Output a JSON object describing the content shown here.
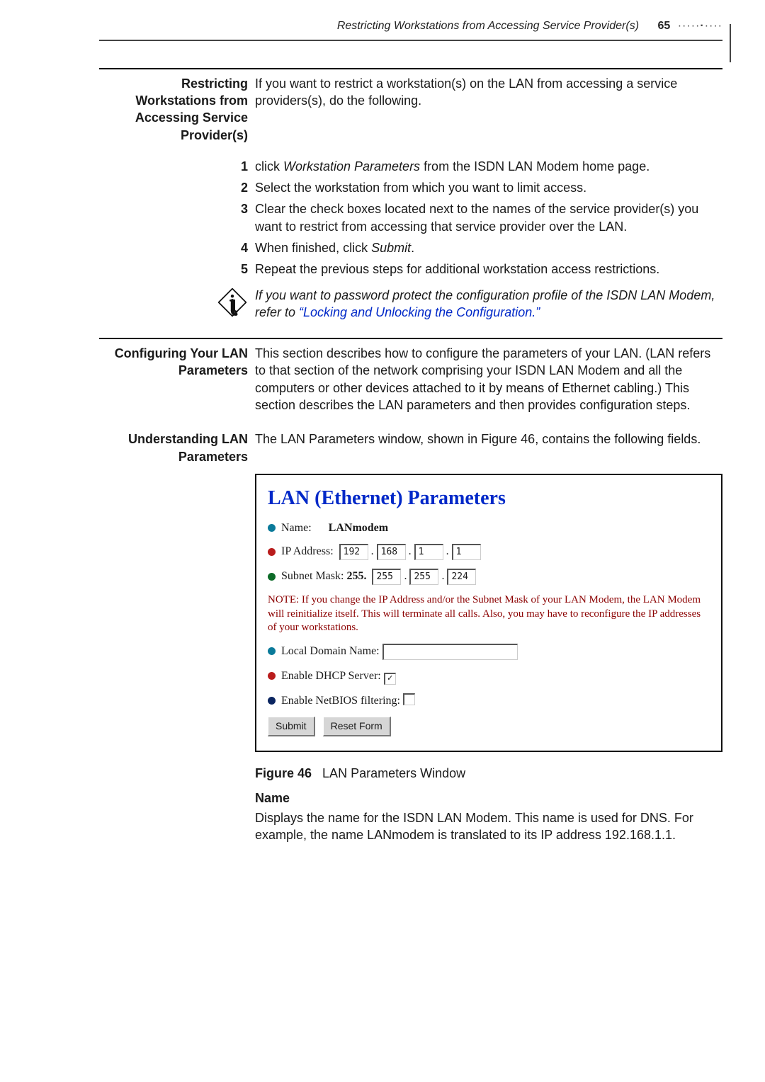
{
  "running": {
    "title": "Restricting Workstations from Accessing Service Provider(s)",
    "page": "65"
  },
  "sec1": {
    "heading": "Restricting Workstations from Accessing Service Provider(s)",
    "intro": "If you want to restrict a workstation(s) on the LAN from accessing a service providers(s), do the following.",
    "steps": {
      "s1a": "click ",
      "s1_em": "Workstation Parameters",
      "s1b": " from the ISDN LAN Modem home page.",
      "s2": "Select the workstation from which you want to limit access.",
      "s3": "Clear the check boxes located next to the names of the service provider(s) you want to restrict from accessing that service provider over the LAN.",
      "s4a": "When finished, click ",
      "s4_em": "Submit",
      "s4b": ".",
      "s5": "Repeat the previous steps for additional workstation access restrictions."
    },
    "infobox": {
      "line1": "If you want to password protect the configuration profile of the ISDN LAN Modem, refer to ",
      "link": "“Locking and Unlocking the Configuration.”"
    }
  },
  "sec2": {
    "heading": "Configuring Your LAN Parameters",
    "body": "This section describes how to configure the parameters of your LAN. (LAN refers to that section of the network comprising your ISDN LAN Modem and all the computers or other devices attached to it by means of Ethernet cabling.) This section describes the LAN parameters and then provides configuration steps."
  },
  "sec3": {
    "heading": "Understanding LAN Parameters",
    "body": "The LAN Parameters window, shown in Figure 46, contains the following fields."
  },
  "panel": {
    "title": "LAN (Ethernet) Parameters",
    "name_label": "Name:",
    "name_value": "LANmodem",
    "ip_label": "IP Address:",
    "ip": {
      "a": "192",
      "b": "168",
      "c": "1",
      "d": "1"
    },
    "mask_label": "Subnet Mask:",
    "mask_fixed": "255.",
    "mask": {
      "a": "255",
      "b": "255",
      "c": "224"
    },
    "note": "NOTE: If you change the IP Address and/or the Subnet Mask of your LAN Modem, the LAN Modem will reinitialize itself. This will terminate all calls. Also, you may have to reconfigure the IP addresses of your workstations.",
    "ldn_label": "Local Domain Name:",
    "dhcp_label": "Enable DHCP Server:",
    "netbios_label": "Enable NetBIOS filtering:",
    "btn_submit": "Submit",
    "btn_reset": "Reset Form"
  },
  "figcap": {
    "label": "Figure 46",
    "text": "LAN Parameters Window"
  },
  "name_section": {
    "heading": "Name",
    "body": "Displays the name for the ISDN LAN Modem. This name is used for DNS. For example, the name LANmodem is translated to its IP address 192.168.1.1."
  }
}
